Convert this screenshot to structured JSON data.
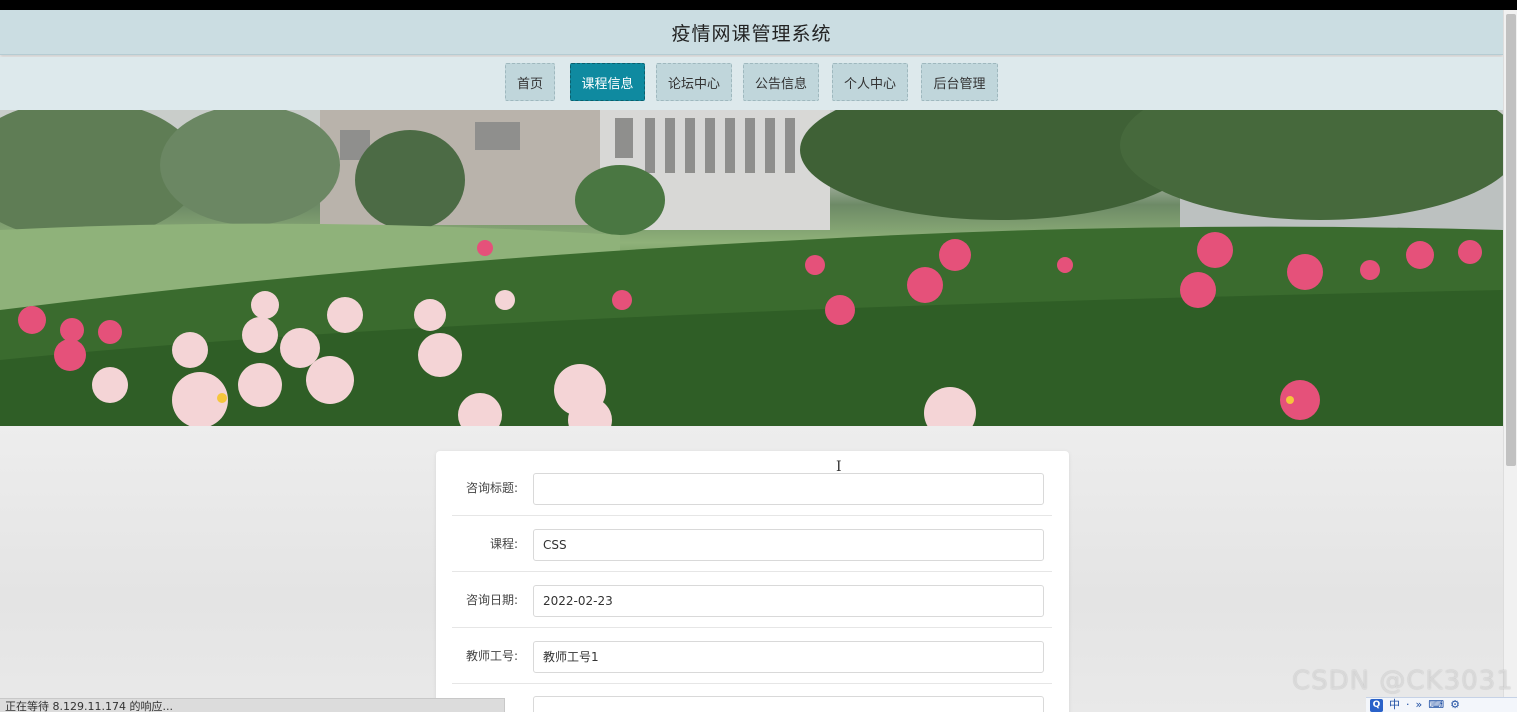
{
  "header": {
    "title": "疫情网课管理系统"
  },
  "nav": {
    "items": [
      {
        "label": "首页",
        "active": false
      },
      {
        "label": "课程信息",
        "active": true
      },
      {
        "label": "论坛中心",
        "active": false
      },
      {
        "label": "公告信息",
        "active": false
      },
      {
        "label": "个人中心",
        "active": false
      },
      {
        "label": "后台管理",
        "active": false
      }
    ]
  },
  "form": {
    "fields": [
      {
        "label": "咨询标题:",
        "value": ""
      },
      {
        "label": "课程:",
        "value": "CSS"
      },
      {
        "label": "咨询日期:",
        "value": "2022-02-23"
      },
      {
        "label": "教师工号:",
        "value": "教师工号1"
      }
    ]
  },
  "status": {
    "text": "正在等待 8.129.11.174 的响应..."
  },
  "watermark": {
    "text": "CSDN @CK3031"
  },
  "ime": {
    "items": [
      "中",
      "·",
      "»",
      "⌨",
      "⚙"
    ]
  },
  "colors": {
    "nav_active": "#0f8aa0",
    "nav_default": "#c0d6db",
    "title_bar": "#cbdde2"
  }
}
